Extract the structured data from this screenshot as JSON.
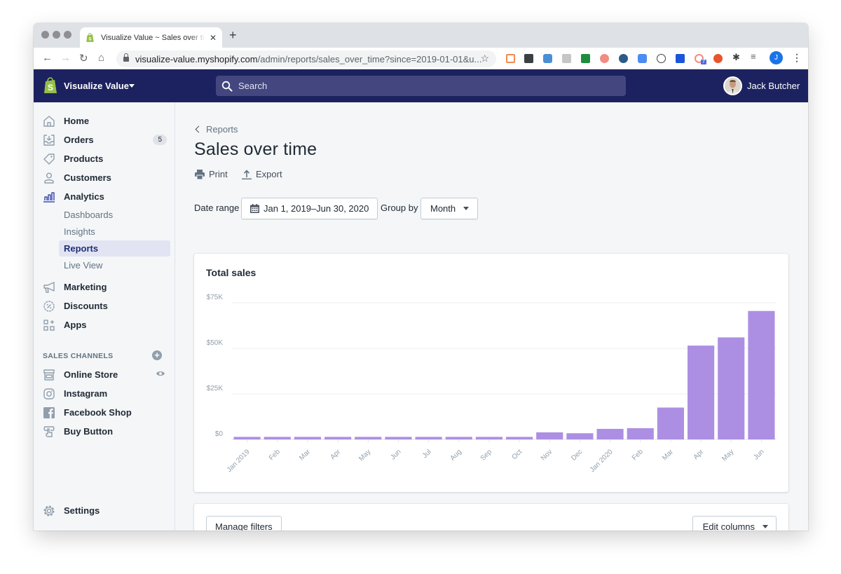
{
  "browser": {
    "tab_title": "Visualize Value ~ Sales over time",
    "new_tab": "+",
    "url_host": "visualize-value.myshopify.com",
    "url_path": "/admin/reports/sales_over_time?since=2019-01-01&u...",
    "profile_initial": "J",
    "extension_badge": "7"
  },
  "topbar": {
    "store_name": "Visualize Value",
    "search_placeholder": "Search",
    "user_name": "Jack Butcher"
  },
  "sidebar": {
    "items": [
      {
        "label": "Home",
        "icon": "home-icon"
      },
      {
        "label": "Orders",
        "icon": "orders-icon",
        "badge": "5"
      },
      {
        "label": "Products",
        "icon": "tag-icon"
      },
      {
        "label": "Customers",
        "icon": "person-icon"
      },
      {
        "label": "Analytics",
        "icon": "analytics-icon",
        "active": true
      }
    ],
    "analytics_sub": [
      {
        "label": "Dashboards"
      },
      {
        "label": "Insights"
      },
      {
        "label": "Reports",
        "active": true
      },
      {
        "label": "Live View"
      }
    ],
    "items2": [
      {
        "label": "Marketing",
        "icon": "megaphone-icon"
      },
      {
        "label": "Discounts",
        "icon": "discount-icon"
      },
      {
        "label": "Apps",
        "icon": "apps-icon"
      }
    ],
    "channels_title": "SALES CHANNELS",
    "channels": [
      {
        "label": "Online Store",
        "icon": "store-icon"
      },
      {
        "label": "Instagram",
        "icon": "instagram-icon"
      },
      {
        "label": "Facebook Shop",
        "icon": "facebook-icon"
      },
      {
        "label": "Buy Button",
        "icon": "buy-button-icon"
      }
    ],
    "settings": "Settings"
  },
  "main": {
    "breadcrumb": "Reports",
    "title": "Sales over time",
    "actions": {
      "print": "Print",
      "export": "Export"
    },
    "date_range_label": "Date range",
    "date_range_value": "Jan 1, 2019–Jun 30, 2020",
    "group_by_label": "Group by",
    "group_by_value": "Month",
    "manage_filters": "Manage filters",
    "edit_columns": "Edit columns"
  },
  "colors": {
    "topbar": "#1c2260",
    "accent": "#202e78",
    "bar": "#ac8fe3"
  },
  "chart_data": {
    "type": "bar",
    "title": "Total sales",
    "xlabel": "",
    "ylabel": "",
    "ylim": [
      0,
      75000
    ],
    "yticks": [
      0,
      25000,
      50000,
      75000
    ],
    "ytick_labels": [
      "$0",
      "$25K",
      "$50K",
      "$75K"
    ],
    "grid": true,
    "categories": [
      "Jan 2019",
      "Feb",
      "Mar",
      "Apr",
      "May",
      "Jun",
      "Jul",
      "Aug",
      "Sep",
      "Oct",
      "Nov",
      "Dec",
      "Jan 2020",
      "Feb",
      "Mar",
      "Apr",
      "May",
      "Jun"
    ],
    "values": [
      1400,
      1400,
      1400,
      1400,
      1400,
      1400,
      1400,
      1400,
      1400,
      1400,
      3900,
      3400,
      5800,
      6200,
      17500,
      51500,
      56000,
      70500
    ]
  }
}
